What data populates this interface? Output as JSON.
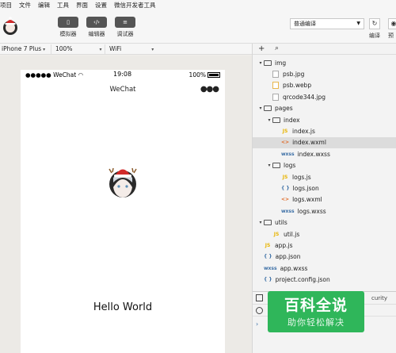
{
  "menu": [
    "项目",
    "文件",
    "编辑",
    "工具",
    "界面",
    "设置",
    "微信开发者工具"
  ],
  "toolbar": {
    "simulator_label": "模拟器",
    "editor_label": "编辑器",
    "debugger_label": "调试器",
    "compile_mode": "普通编译",
    "compile_label": "编译",
    "preview_label": "预"
  },
  "device_bar": {
    "device": "iPhone 7 Plus",
    "zoom": "100%",
    "network": "WiFi"
  },
  "phone": {
    "carrier": "●●●●● WeChat",
    "time": "19:08",
    "battery": "100%",
    "nav_title": "WeChat",
    "nav_dots": "●●●",
    "hello_text": "Hello World"
  },
  "explorer": {
    "add_icon": "+",
    "search_icon": "⌕",
    "tree": [
      {
        "label": "img",
        "type": "folder",
        "level": 0,
        "expanded": true
      },
      {
        "label": "psb.jpg",
        "type": "image",
        "level": 1
      },
      {
        "label": "psb.webp",
        "type": "image-yellow",
        "level": 1
      },
      {
        "label": "qrcode344.jpg",
        "type": "image",
        "level": 1
      },
      {
        "label": "pages",
        "type": "folder",
        "level": 0,
        "expanded": true
      },
      {
        "label": "index",
        "type": "folder",
        "level": 1,
        "expanded": true
      },
      {
        "label": "index.js",
        "type": "js",
        "level": 2
      },
      {
        "label": "index.wxml",
        "type": "wxml",
        "level": 2,
        "selected": true
      },
      {
        "label": "index.wxss",
        "type": "wxss",
        "level": 2
      },
      {
        "label": "logs",
        "type": "folder",
        "level": 1,
        "expanded": true
      },
      {
        "label": "logs.js",
        "type": "js",
        "level": 2
      },
      {
        "label": "logs.json",
        "type": "json",
        "level": 2
      },
      {
        "label": "logs.wxml",
        "type": "wxml",
        "level": 2
      },
      {
        "label": "logs.wxss",
        "type": "wxss",
        "level": 2
      },
      {
        "label": "utils",
        "type": "folder",
        "level": 0,
        "expanded": true
      },
      {
        "label": "util.js",
        "type": "js",
        "level": 1
      },
      {
        "label": "app.js",
        "type": "js",
        "level": 0
      },
      {
        "label": "app.json",
        "type": "json",
        "level": 0
      },
      {
        "label": "app.wxss",
        "type": "wxss",
        "level": 0
      },
      {
        "label": "project.config.json",
        "type": "json",
        "level": 0
      }
    ]
  },
  "file_icons": {
    "js": "JS",
    "wxml": "<>",
    "wxss": "wxss",
    "json": "{ }"
  },
  "console": {
    "tab_security": "curity",
    "filter_text": "to",
    "prompt": "›"
  },
  "watermark": {
    "main": "百科全说",
    "sub": "助你轻松解决"
  },
  "colors": {
    "js": "#e8b400",
    "wxml": "#e06c2a",
    "wxss": "#3a6ea5",
    "json": "#3a6ea5",
    "watermark_bg": "#2fb65a"
  }
}
